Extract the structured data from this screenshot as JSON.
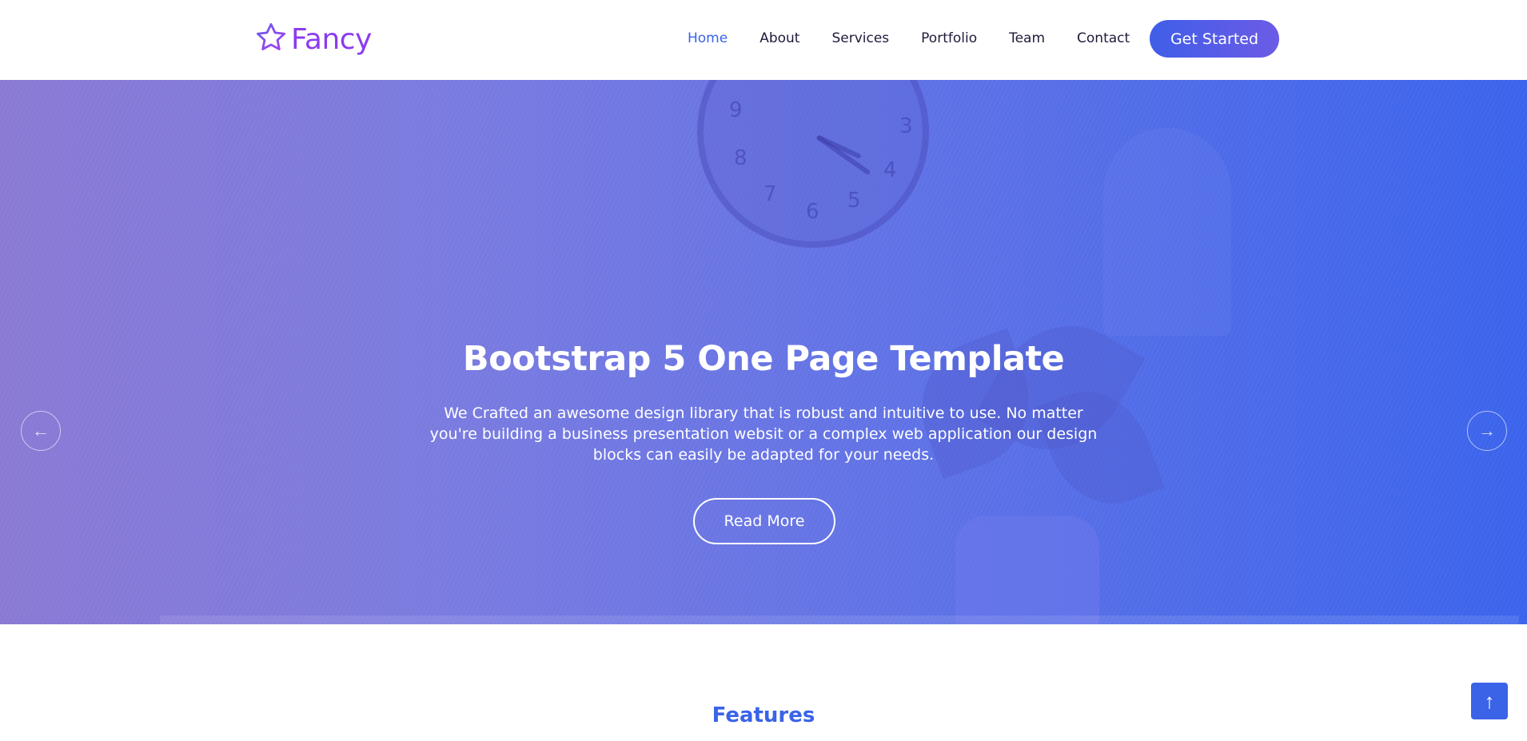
{
  "brand": {
    "name": "Fancy",
    "logo_icon": "star-outline-icon",
    "colors": {
      "logo": "#8b3cf0",
      "accent": "#3a63e8"
    }
  },
  "nav": {
    "items": [
      {
        "label": "Home",
        "active": true
      },
      {
        "label": "About",
        "active": false
      },
      {
        "label": "Services",
        "active": false
      },
      {
        "label": "Portfolio",
        "active": false
      },
      {
        "label": "Team",
        "active": false
      },
      {
        "label": "Contact",
        "active": false
      }
    ],
    "cta_label": "Get Started"
  },
  "hero": {
    "title": "Bootstrap 5 One Page Template",
    "description": "We Crafted an awesome design library that is robust and intuitive to use. No matter you're building a business presentation websit or a complex web application our design blocks can easily be adapted for your needs.",
    "button_label": "Read More",
    "prev_icon": "arrow-left-icon",
    "next_icon": "arrow-right-icon",
    "prev_glyph": "←",
    "next_glyph": "→",
    "clock_numbers": [
      "3",
      "4",
      "5",
      "6",
      "7",
      "8",
      "9"
    ]
  },
  "features": {
    "title": "Features"
  },
  "back_to_top": {
    "icon": "arrow-up-icon",
    "glyph": "↑"
  }
}
